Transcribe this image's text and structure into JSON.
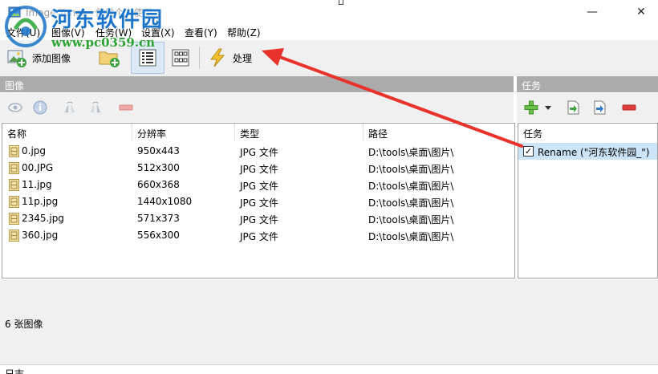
{
  "window": {
    "title": "Image Tuner - 仅供个人使用",
    "minimize_glyph": "—",
    "close_glyph": "✕"
  },
  "watermark": {
    "brand": "河东软件园",
    "url": "www.pc0359.cn"
  },
  "menu": {
    "items": [
      "文件(U)",
      "图像(V)",
      "任务(W)",
      "设置(X)",
      "查看(Y)",
      "帮助(Z)"
    ]
  },
  "toolbar": {
    "add_image_label": "添加图像",
    "process_label": "处理"
  },
  "images_panel": {
    "header": "图像",
    "columns": [
      "名称",
      "分辨率",
      "类型",
      "路径"
    ],
    "rows": [
      {
        "name": "0.jpg",
        "resolution": "950x443",
        "type": "JPG 文件",
        "path": "D:\\tools\\桌面\\图片\\"
      },
      {
        "name": "00.JPG",
        "resolution": "512x300",
        "type": "JPG 文件",
        "path": "D:\\tools\\桌面\\图片\\"
      },
      {
        "name": "11.jpg",
        "resolution": "660x368",
        "type": "JPG 文件",
        "path": "D:\\tools\\桌面\\图片\\"
      },
      {
        "name": "11p.jpg",
        "resolution": "1440x1080",
        "type": "JPG 文件",
        "path": "D:\\tools\\桌面\\图片\\"
      },
      {
        "name": "2345.jpg",
        "resolution": "571x373",
        "type": "JPG 文件",
        "path": "D:\\tools\\桌面\\图片\\"
      },
      {
        "name": "360.jpg",
        "resolution": "556x300",
        "type": "JPG 文件",
        "path": "D:\\tools\\桌面\\图片\\"
      }
    ]
  },
  "tasks_panel": {
    "header": "任务",
    "column": "任务",
    "items": [
      {
        "label": "Rename (\"河东软件园_\")",
        "checked": true
      }
    ]
  },
  "status": {
    "image_count": "6 张图像",
    "log_label": "日志"
  },
  "colors": {
    "panel_header": "#ababab",
    "selection": "#cce4f7",
    "annotation_arrow": "#e8322b",
    "watermark_blue": "#1a74c9",
    "watermark_green": "#2aa332"
  }
}
